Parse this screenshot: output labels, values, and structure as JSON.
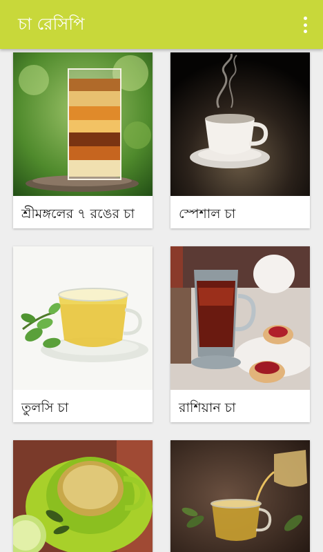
{
  "app": {
    "title": "চা রেসিপি"
  },
  "cards": [
    {
      "label": "শ্রীমঙ্গলের ৭ রঙের চা",
      "image": "seven-layer-tea-photo"
    },
    {
      "label": "স্পেশাল চা",
      "image": "special-tea-cup-photo"
    },
    {
      "label": "তুলসি চা",
      "image": "tulsi-tea-photo"
    },
    {
      "label": "রাশিয়ান চা",
      "image": "russian-tea-photo"
    },
    {
      "label": "",
      "image": "green-tea-cup-photo"
    },
    {
      "label": "",
      "image": "herbal-tea-pour-photo"
    }
  ],
  "icons": {
    "overflow": "more-vert-icon"
  },
  "colors": {
    "appbar": "#c8d83a",
    "background": "#eeeeee",
    "card": "#ffffff"
  }
}
